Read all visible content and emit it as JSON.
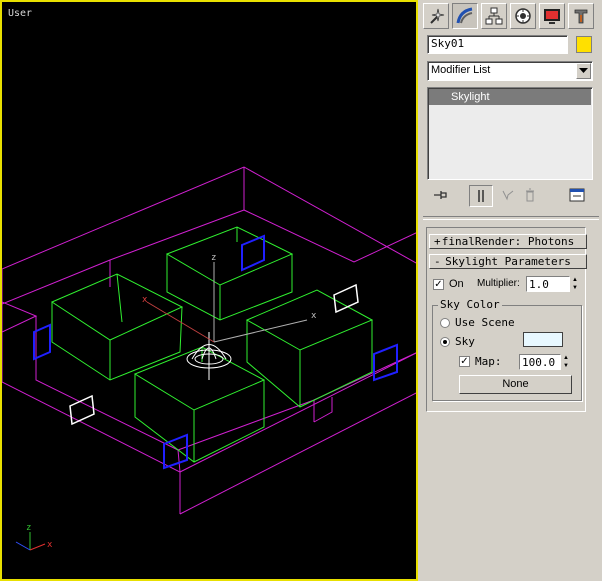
{
  "viewport": {
    "label": "User",
    "axis_x": "x",
    "axis_z": "z",
    "gizmo_x": "x",
    "gizmo_z": "z"
  },
  "command_panel": {
    "tabs": [
      "create-icon",
      "modify-icon",
      "hierarchy-icon",
      "motion-icon",
      "display-icon",
      "utilities-icon"
    ],
    "object_name": "Sky01",
    "object_color": "#ffe000",
    "modifier_list": "Modifier List",
    "stack_items": [
      "Skylight"
    ]
  },
  "rollouts": {
    "final_render": "finalRender: Photons",
    "skylight_params": "Skylight Parameters",
    "on_label": "On",
    "on_checked": true,
    "multiplier_label": "Multiplier:",
    "multiplier_value": "1.0",
    "sky_color_title": "Sky Color",
    "use_scene_label": "Use Scene",
    "sky_label": "Sky",
    "sky_swatch_color": "#e8f8ff",
    "map_label": "Map:",
    "map_checked": true,
    "map_value": "100.0",
    "map_button": "None",
    "open_symbol": "-",
    "closed_symbol": "+"
  }
}
